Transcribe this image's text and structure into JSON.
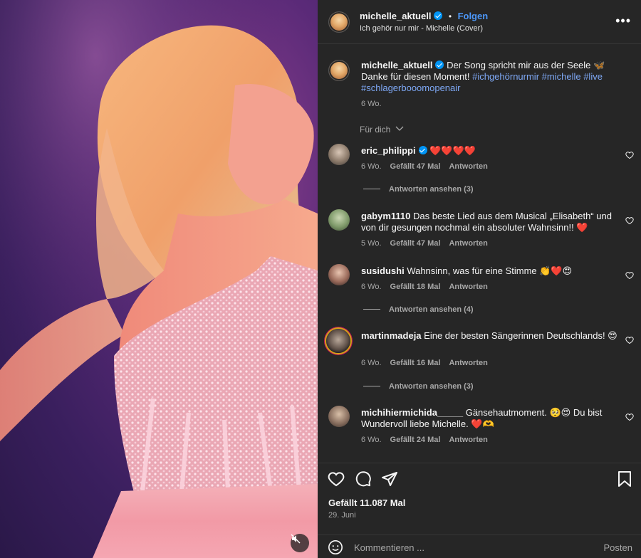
{
  "post": {
    "author": "michelle_aktuell",
    "follow_label": "Folgen",
    "separator": "•",
    "audio": "Ich gehör nur mir - Michelle (Cover)",
    "more_label": "•••"
  },
  "caption": {
    "author": "michelle_aktuell",
    "text": "Der Song spricht mir aus der Seele 🦋 Danke für diesen Moment!",
    "hashtags": [
      "#ichgehörnurmir",
      "#michelle",
      "#live",
      "#schlagerbooomopenair"
    ],
    "age": "6 Wo."
  },
  "sort_label": "Für dich",
  "comments": [
    {
      "user": "eric_philippi",
      "verified": true,
      "text": "❤️❤️❤️❤️",
      "age": "6 Wo.",
      "likes": "Gefällt 47 Mal",
      "reply": "Antworten",
      "view_replies": "Antworten ansehen (3)"
    },
    {
      "user": "gabym1110",
      "verified": false,
      "text": "Das beste Lied aus dem Musical „Elisabeth“ und von dir gesungen nochmal ein absoluter Wahnsinn!! ❤️",
      "age": "5 Wo.",
      "likes": "Gefällt 47 Mal",
      "reply": "Antworten",
      "view_replies": ""
    },
    {
      "user": "susidushi",
      "verified": false,
      "text": "Wahnsinn, was für eine Stimme 👏❤️😍",
      "age": "6 Wo.",
      "likes": "Gefällt 18 Mal",
      "reply": "Antworten",
      "view_replies": "Antworten ansehen (4)"
    },
    {
      "user": "martinmadeja",
      "verified": false,
      "text": "Eine der besten Sängerinnen Deutschlands! 😍",
      "age": "6 Wo.",
      "likes": "Gefällt 16 Mal",
      "reply": "Antworten",
      "view_replies": "Antworten ansehen (3)"
    },
    {
      "user": "michihiermichida_____",
      "verified": false,
      "text": "Gänsehautmoment. 🥺😍 Du bist Wundervoll liebe Michelle. ❤️🫶",
      "age": "6 Wo.",
      "likes": "Gefällt 24 Mal",
      "reply": "Antworten",
      "view_replies": ""
    }
  ],
  "footer": {
    "likes": "Gefällt 11.087 Mal",
    "date": "29. Juni",
    "comment_placeholder": "Kommentieren ...",
    "post_label": "Posten"
  },
  "colors": {
    "panel_bg": "#262626",
    "accent_blue": "#4c97f8",
    "hashtag": "#7ea8f5",
    "muted": "#a8a8a8"
  },
  "icons": [
    "verified-badge-icon",
    "more-options-icon",
    "heart-icon",
    "comment-icon",
    "share-icon",
    "bookmark-icon",
    "emoji-icon",
    "mute-icon",
    "chevron-down-icon"
  ]
}
